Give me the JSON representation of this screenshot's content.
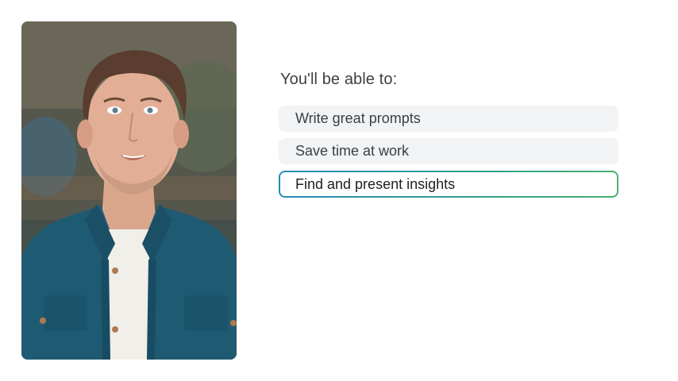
{
  "video": {
    "subject": "presenter"
  },
  "content": {
    "heading": "You'll be able to:",
    "options": [
      {
        "label": "Write great prompts",
        "selected": false
      },
      {
        "label": "Save time at work",
        "selected": false
      },
      {
        "label": "Find and present insights",
        "selected": true
      }
    ]
  },
  "colors": {
    "option_background": "#f1f3f4",
    "selected_border_start": "#2a8ab8",
    "selected_border_end": "#4cae6f",
    "text": "#3c4043"
  }
}
